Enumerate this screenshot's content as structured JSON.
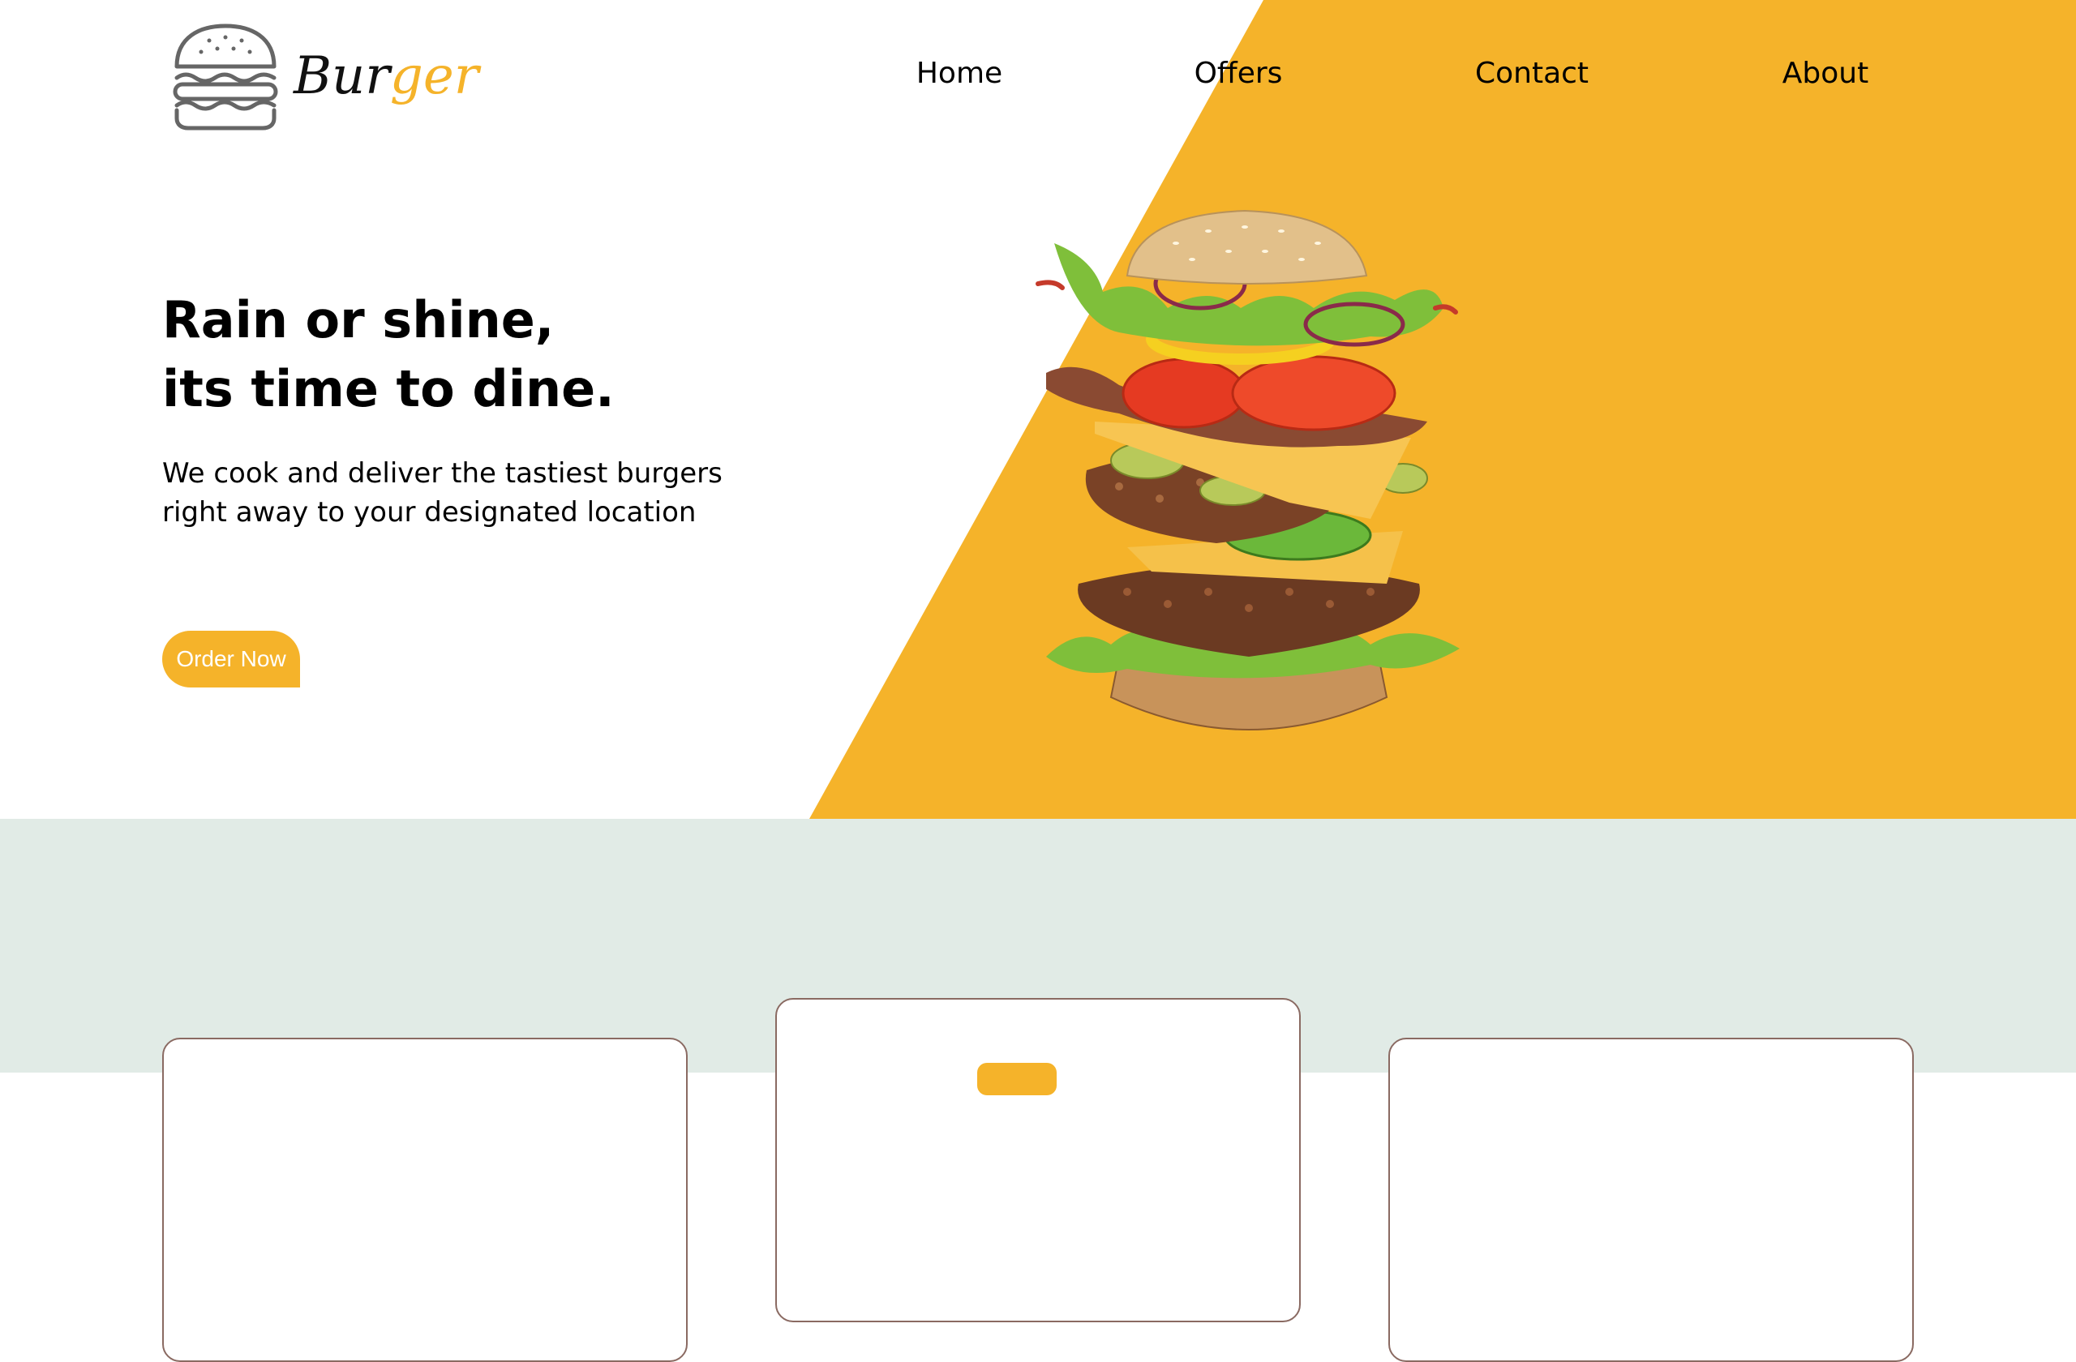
{
  "brand": {
    "name_part1": "Bur",
    "name_part2": "ger",
    "icon": "burger-outline-icon",
    "accent_color": "#f5b32a"
  },
  "nav": {
    "items": [
      {
        "label": "Home"
      },
      {
        "label": "Offers"
      },
      {
        "label": "Contact"
      },
      {
        "label": "About"
      }
    ]
  },
  "hero": {
    "headline_line1": "Rain or shine,",
    "headline_line2": "its time to dine.",
    "subtext_line1": "We cook and deliver the tastiest burgers",
    "subtext_line2": "right away to your designated location",
    "cta_label": "Order Now",
    "image": "exploded-burger-image",
    "background_accent": "#f5b32a"
  },
  "section": {
    "background_color": "#e1ebe6"
  }
}
